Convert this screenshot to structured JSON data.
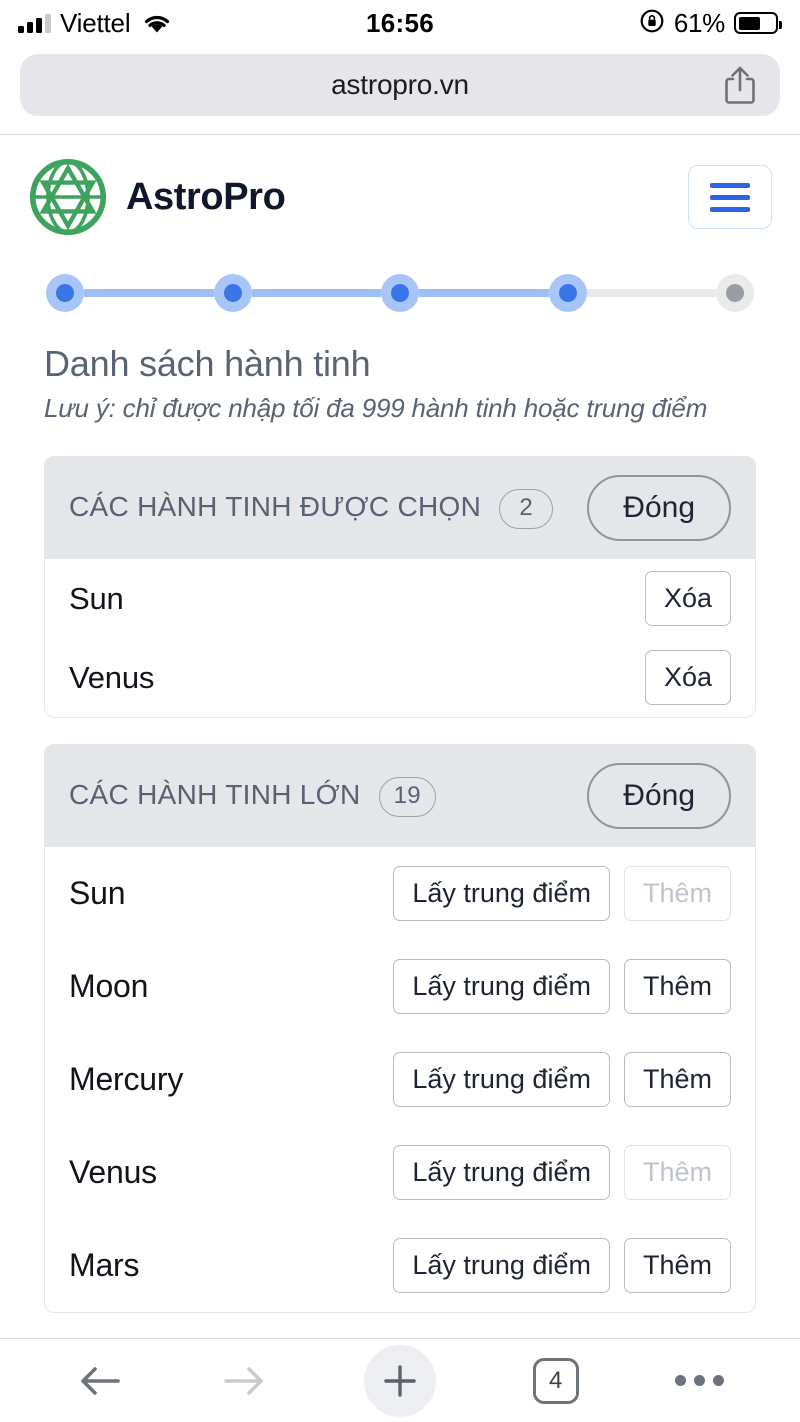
{
  "status_bar": {
    "carrier": "Viettel",
    "time": "16:56",
    "battery_percent": "61%",
    "icons": [
      "signal-bars-icon",
      "wifi-icon",
      "rotation-lock-icon",
      "battery-icon"
    ]
  },
  "browser": {
    "url": "astropro.vn",
    "share_icon": "share-icon",
    "toolbar": {
      "back_icon": "back-arrow-icon",
      "forward_icon": "forward-arrow-icon",
      "new_tab_icon": "plus-icon",
      "tab_count": "4",
      "more_icon": "more-dots-icon"
    }
  },
  "site_header": {
    "brand": "AstroPro",
    "logo_icon": "astropro-hexagram-logo",
    "menu_icon": "hamburger-menu-icon"
  },
  "stepper": {
    "steps": [
      {
        "state": "active"
      },
      {
        "state": "active"
      },
      {
        "state": "active"
      },
      {
        "state": "active"
      },
      {
        "state": "idle"
      }
    ],
    "active_color": "#3b76e8",
    "active_halo": "#a8c5f7",
    "idle_color": "#9a9da3",
    "line_active": "#9fc0f6",
    "line_idle": "#e9eaec"
  },
  "page": {
    "title": "Danh sách hành tinh",
    "note": "Lưu ý: chỉ được nhập tối đa 999 hành tinh hoặc trung điểm"
  },
  "selected_card": {
    "title": "CÁC HÀNH TINH ĐƯỢC CHỌN",
    "count": "2",
    "close_label": "Đóng",
    "rows": [
      {
        "name": "Sun",
        "delete_label": "Xóa"
      },
      {
        "name": "Venus",
        "delete_label": "Xóa"
      }
    ]
  },
  "major_card": {
    "title": "CÁC HÀNH TINH LỚN",
    "count": "19",
    "close_label": "Đóng",
    "midpoint_label": "Lấy trung điểm",
    "add_label": "Thêm",
    "rows": [
      {
        "name": "Sun",
        "midpoint_label": "Lấy trung điểm",
        "add_label": "Thêm",
        "add_disabled": true
      },
      {
        "name": "Moon",
        "midpoint_label": "Lấy trung điểm",
        "add_label": "Thêm",
        "add_disabled": false
      },
      {
        "name": "Mercury",
        "midpoint_label": "Lấy trung điểm",
        "add_label": "Thêm",
        "add_disabled": false
      },
      {
        "name": "Venus",
        "midpoint_label": "Lấy trung điểm",
        "add_label": "Thêm",
        "add_disabled": true
      },
      {
        "name": "Mars",
        "midpoint_label": "Lấy trung điểm",
        "add_label": "Thêm",
        "add_disabled": false
      }
    ]
  },
  "colors": {
    "brand_green": "#3da35d",
    "accent_blue": "#2f62e8",
    "card_header_bg": "#e4e6e9",
    "muted_text": "#5a6372"
  }
}
